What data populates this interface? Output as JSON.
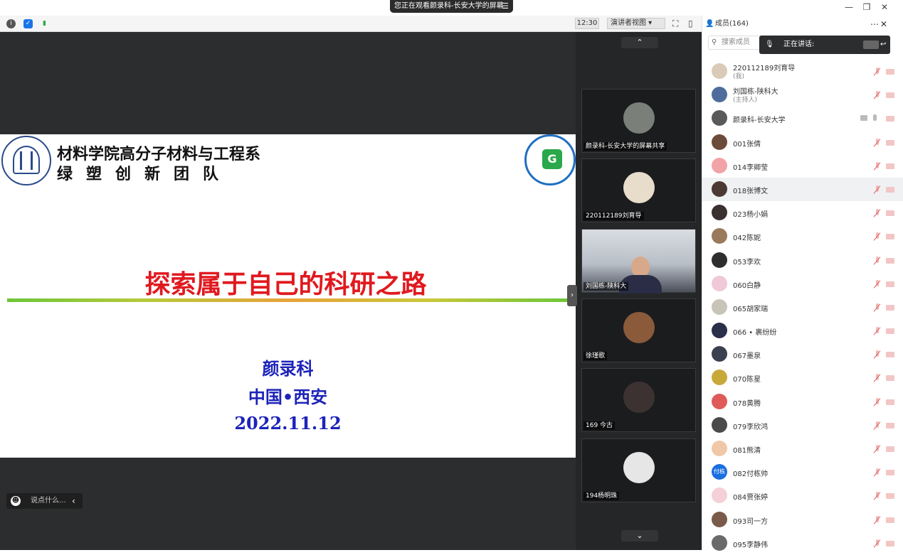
{
  "titlebar": {
    "share_banner": "您正在观看颜录科-长安大学的屏幕",
    "menu_icon": "menu-icon",
    "minimize": "—",
    "restore": "❐",
    "close": "✕"
  },
  "toolbar": {
    "time": "12:30",
    "view_mode": "演讲者视图 ▾",
    "info_icon": "info-icon",
    "shield_icon": "shield-icon",
    "signal_icon": "signal-icon"
  },
  "slide": {
    "department": "材料学院高分子材料与工程系",
    "team": "绿塑创新团队",
    "title": "探索属于自己的科研之路",
    "author": "颜录科",
    "city": "中国•西安",
    "date": "2022.11.12"
  },
  "chat": {
    "placeholder": "说点什么..."
  },
  "video_strip": {
    "tiles": [
      {
        "label": "颜录科-长安大学的屏幕共享",
        "avatar_color": "#7b7f7a"
      },
      {
        "label": "220112189刘育导",
        "avatar_color": "#e8dccb"
      },
      {
        "label": "刘国栋-陕科大",
        "avatar_color": "#d7a98a"
      },
      {
        "label": "徐瑾歌",
        "avatar_color": "#8a5a3a"
      },
      {
        "label": "169 今古",
        "avatar_color": "#3c3232"
      },
      {
        "label": "194杨明珠",
        "avatar_color": "#e6e6e6"
      }
    ]
  },
  "panel": {
    "title": "成员(164)",
    "search_placeholder": "搜索成员",
    "speaking_label": "正在讲话:",
    "members": [
      {
        "name": "220112189刘育导",
        "role": "(我)",
        "color": "#d9cbb7"
      },
      {
        "name": "刘国栋-陕科大",
        "role": "(主持人)",
        "color": "#4e6d9c"
      },
      {
        "name": "颜录科-长安大学",
        "role": "",
        "color": "#5a5a5a"
      },
      {
        "name": "001张倩",
        "role": "",
        "color": "#6b4b3a"
      },
      {
        "name": "014李卿莹",
        "role": "",
        "color": "#f2a3a8"
      },
      {
        "name": "018张博文",
        "role": "",
        "color": "#4a3a33"
      },
      {
        "name": "023杨小娟",
        "role": "",
        "color": "#3a3030"
      },
      {
        "name": "042陈妮",
        "role": "",
        "color": "#9a7a5a"
      },
      {
        "name": "053李欢",
        "role": "",
        "color": "#2e2e2e"
      },
      {
        "name": "060白静",
        "role": "",
        "color": "#f0c8d8"
      },
      {
        "name": "065胡家瑞",
        "role": "",
        "color": "#c8c4b8"
      },
      {
        "name": "066 • 裹纷纷",
        "role": "",
        "color": "#2a2f4a"
      },
      {
        "name": "067墨泉",
        "role": "",
        "color": "#3a4050"
      },
      {
        "name": "070陈星",
        "role": "",
        "color": "#c9a83a"
      },
      {
        "name": "078黄腾",
        "role": "",
        "color": "#e05a5a"
      },
      {
        "name": "079李欣鸿",
        "role": "",
        "color": "#4a4a4a"
      },
      {
        "name": "081熊清",
        "role": "",
        "color": "#f0c8a8"
      },
      {
        "name": "082付栋帅",
        "role": "",
        "color": "#1a6fe0",
        "initial": "付栋"
      },
      {
        "name": "084贾张婷",
        "role": "",
        "color": "#f5d0d8"
      },
      {
        "name": "093司一方",
        "role": "",
        "color": "#7a5a4a"
      },
      {
        "name": "095李静伟",
        "role": "",
        "color": "#6a6a6a"
      }
    ]
  }
}
